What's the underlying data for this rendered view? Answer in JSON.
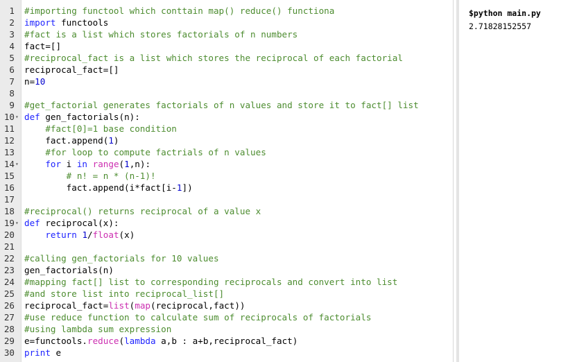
{
  "editor": {
    "lines": [
      {
        "n": "1",
        "fold": "",
        "tokens": [
          {
            "t": "#importing functool which conttain map() reduce() functiona",
            "c": "comment"
          }
        ]
      },
      {
        "n": "2",
        "fold": "",
        "tokens": [
          {
            "t": "import",
            "c": "keyword"
          },
          {
            "t": " functools",
            "c": "plain"
          }
        ]
      },
      {
        "n": "3",
        "fold": "",
        "tokens": [
          {
            "t": "#fact is a list which stores factorials of n numbers",
            "c": "comment"
          }
        ]
      },
      {
        "n": "4",
        "fold": "",
        "tokens": [
          {
            "t": "fact=[]",
            "c": "plain"
          }
        ]
      },
      {
        "n": "5",
        "fold": "",
        "tokens": [
          {
            "t": "#reciprocal_fact is a list which stores the reciprocal of each factorial",
            "c": "comment"
          }
        ]
      },
      {
        "n": "6",
        "fold": "",
        "tokens": [
          {
            "t": "reciprocal_fact=[]",
            "c": "plain"
          }
        ]
      },
      {
        "n": "7",
        "fold": "",
        "tokens": [
          {
            "t": "n=",
            "c": "plain"
          },
          {
            "t": "10",
            "c": "number"
          }
        ]
      },
      {
        "n": "8",
        "fold": "",
        "tokens": []
      },
      {
        "n": "9",
        "fold": "",
        "tokens": [
          {
            "t": "#get_factorial generates factorials of n values and store it to fact[] list",
            "c": "comment"
          }
        ]
      },
      {
        "n": "10",
        "fold": "▾",
        "tokens": [
          {
            "t": "def",
            "c": "keyword"
          },
          {
            "t": " gen_factorials(n):",
            "c": "plain"
          }
        ]
      },
      {
        "n": "11",
        "fold": "",
        "tokens": [
          {
            "t": "    #fact[0]=1 base condition",
            "c": "comment"
          }
        ]
      },
      {
        "n": "12",
        "fold": "",
        "tokens": [
          {
            "t": "    fact.append(",
            "c": "plain"
          },
          {
            "t": "1",
            "c": "number"
          },
          {
            "t": ")",
            "c": "plain"
          }
        ]
      },
      {
        "n": "13",
        "fold": "",
        "tokens": [
          {
            "t": "    #for loop to compute factrials of n values",
            "c": "comment"
          }
        ]
      },
      {
        "n": "14",
        "fold": "▾",
        "tokens": [
          {
            "t": "    ",
            "c": "plain"
          },
          {
            "t": "for",
            "c": "keyword"
          },
          {
            "t": " i ",
            "c": "plain"
          },
          {
            "t": "in",
            "c": "keyword"
          },
          {
            "t": " ",
            "c": "plain"
          },
          {
            "t": "range",
            "c": "builtin"
          },
          {
            "t": "(",
            "c": "plain"
          },
          {
            "t": "1",
            "c": "number"
          },
          {
            "t": ",n):",
            "c": "plain"
          }
        ]
      },
      {
        "n": "15",
        "fold": "",
        "tokens": [
          {
            "t": "        # n! = n * (n-1)!",
            "c": "comment"
          }
        ]
      },
      {
        "n": "16",
        "fold": "",
        "tokens": [
          {
            "t": "        fact.append(i*fact[i-",
            "c": "plain"
          },
          {
            "t": "1",
            "c": "number"
          },
          {
            "t": "])",
            "c": "plain"
          }
        ]
      },
      {
        "n": "17",
        "fold": "",
        "tokens": []
      },
      {
        "n": "18",
        "fold": "",
        "tokens": [
          {
            "t": "#reciprocal() returns reciprocal of a value x",
            "c": "comment"
          }
        ]
      },
      {
        "n": "19",
        "fold": "▾",
        "tokens": [
          {
            "t": "def",
            "c": "keyword"
          },
          {
            "t": " reciprocal(x):",
            "c": "plain"
          }
        ]
      },
      {
        "n": "20",
        "fold": "",
        "tokens": [
          {
            "t": "    ",
            "c": "plain"
          },
          {
            "t": "return",
            "c": "keyword"
          },
          {
            "t": " ",
            "c": "plain"
          },
          {
            "t": "1",
            "c": "number"
          },
          {
            "t": "/",
            "c": "plain"
          },
          {
            "t": "float",
            "c": "builtin"
          },
          {
            "t": "(x)",
            "c": "plain"
          }
        ]
      },
      {
        "n": "21",
        "fold": "",
        "tokens": []
      },
      {
        "n": "22",
        "fold": "",
        "tokens": [
          {
            "t": "#calling gen_factorials for 10 values",
            "c": "comment"
          }
        ]
      },
      {
        "n": "23",
        "fold": "",
        "tokens": [
          {
            "t": "gen_factorials(n)",
            "c": "plain"
          }
        ]
      },
      {
        "n": "24",
        "fold": "",
        "tokens": [
          {
            "t": "#mapping fact[] list to corresponding reciprocals and convert into list",
            "c": "comment"
          }
        ]
      },
      {
        "n": "25",
        "fold": "",
        "tokens": [
          {
            "t": "#and store list into reciprocal_list[]",
            "c": "comment"
          }
        ]
      },
      {
        "n": "26",
        "fold": "",
        "tokens": [
          {
            "t": "reciprocal_fact=",
            "c": "plain"
          },
          {
            "t": "list",
            "c": "builtin"
          },
          {
            "t": "(",
            "c": "plain"
          },
          {
            "t": "map",
            "c": "builtin"
          },
          {
            "t": "(reciprocal,fact))",
            "c": "plain"
          }
        ]
      },
      {
        "n": "27",
        "fold": "",
        "tokens": [
          {
            "t": "#use reduce function to calculate sum of reciprocals of factorials",
            "c": "comment"
          }
        ]
      },
      {
        "n": "28",
        "fold": "",
        "tokens": [
          {
            "t": "#using lambda sum expression",
            "c": "comment"
          }
        ]
      },
      {
        "n": "29",
        "fold": "",
        "tokens": [
          {
            "t": "e=functools.",
            "c": "plain"
          },
          {
            "t": "reduce",
            "c": "builtin"
          },
          {
            "t": "(",
            "c": "plain"
          },
          {
            "t": "lambda",
            "c": "keyword"
          },
          {
            "t": " a,b : a+b,reciprocal_fact)",
            "c": "plain"
          }
        ]
      },
      {
        "n": "30",
        "fold": "",
        "tokens": [
          {
            "t": "print",
            "c": "keyword"
          },
          {
            "t": " e",
            "c": "plain"
          }
        ]
      }
    ]
  },
  "terminal": {
    "command": "$python main.py",
    "output": "2.71828152557"
  }
}
